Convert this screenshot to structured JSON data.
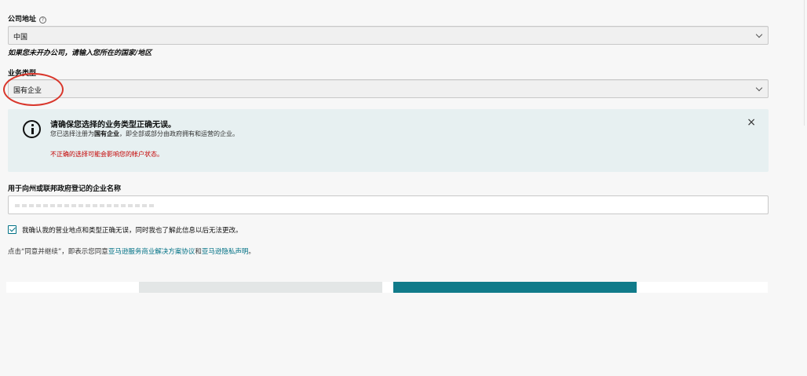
{
  "company_address": {
    "label": "公司地址",
    "help_icon": "?",
    "selected": "中国",
    "hint": "如果您未开办公司，请输入您所在的国家/地区"
  },
  "business_type": {
    "label": "业务类型",
    "selected": "国有企业"
  },
  "alert": {
    "icon": "info-icon",
    "title": "请确保您选择的业务类型正确无误。",
    "desc_prefix": "您已选择注册为",
    "desc_bold": "国有企业",
    "desc_suffix": "，即全部或部分由政府拥有和运营的企业。",
    "warning": "不正确的选择可能会影响您的帐户状态。",
    "close": "×"
  },
  "registered_name": {
    "label": "用于向州或联邦政府登记的企业名称"
  },
  "confirm": {
    "checked": true,
    "label": "我确认我的营业地点和类型正确无误，同时我也了解此信息以后无法更改。"
  },
  "consent": {
    "prefix": "点击“同意并继续”，即表示您同意",
    "link1": "亚马逊服务商业解决方案协议",
    "middle": "和",
    "link2": "亚马逊隐私声明",
    "suffix": "。"
  },
  "colors": {
    "accent": "#007185",
    "primary_button": "#117b8a",
    "warning": "#c40000",
    "annotation": "#d9362b",
    "alert_bg": "#e7f0f1"
  }
}
